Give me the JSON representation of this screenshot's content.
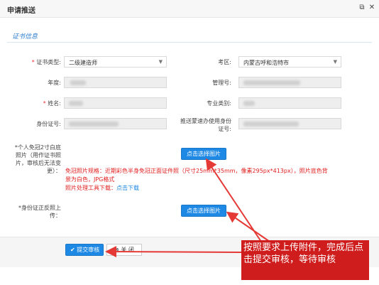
{
  "dialog": {
    "title": "申请推送",
    "restore_icon": "restore-window-icon",
    "close_icon": "close-icon"
  },
  "section": {
    "title": "证书信息"
  },
  "fields": {
    "cert_type": {
      "label": "证书类型:",
      "required": true,
      "value": "二级建造师"
    },
    "region": {
      "label": "考区:",
      "required": false,
      "value": "内蒙古呼和浩特市"
    },
    "year": {
      "label": "年度:",
      "required": false,
      "value": ""
    },
    "mgmt_no": {
      "label": "管理号:",
      "required": false,
      "value": ""
    },
    "name": {
      "label": "姓名:",
      "required": true,
      "value": ""
    },
    "major": {
      "label": "专业类别:",
      "required": false,
      "value": ""
    },
    "id_no": {
      "label": "身份证号:",
      "required": false,
      "value": ""
    },
    "push_id": {
      "label": "推送蒙速办使用身份证号:",
      "required": false,
      "value": ""
    }
  },
  "uploads": {
    "photo": {
      "label": "*个人免冠2寸白底照片（用作证书照片，审核后无法变更）：",
      "button": "点击选择图片"
    },
    "idcard": {
      "label": "*身份证正反照上传：",
      "button": "点击选择图片"
    }
  },
  "notes": {
    "line1": "免冠照片规格：近期彩色半身免冠正面证件照（尺寸25mm*35mm，像素295px*413px），照片底色背景为白色，JPG格式",
    "line2_prefix": "照片处理工具下载：",
    "line2_link": "点击下载"
  },
  "footer": {
    "submit": "提交审核",
    "close": "关 闭"
  },
  "annotation": {
    "text": "按照要求上传附件，完成后点击提交审核，等待审核",
    "color": "#cf1d1d"
  }
}
